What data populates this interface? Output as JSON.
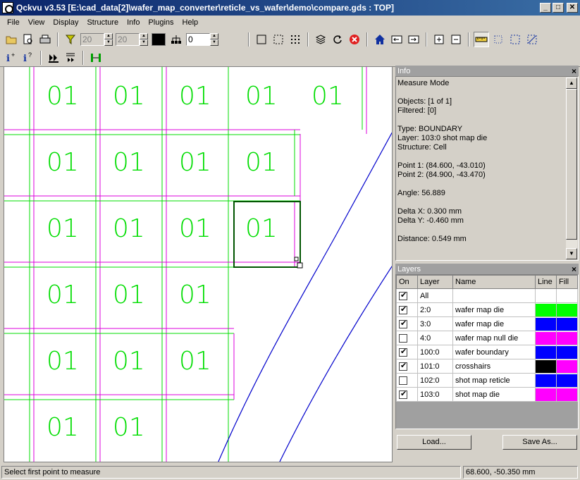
{
  "window": {
    "title": "Qckvu v3.53 [E:\\cad_data[2]\\wafer_map_converter\\reticle_vs_wafer\\demo\\compare.gds : TOP]",
    "minimize": "_",
    "maximize": "□",
    "close": "✕"
  },
  "menu": [
    "File",
    "View",
    "Display",
    "Structure",
    "Info",
    "Plugins",
    "Help"
  ],
  "toolbar": {
    "filter_min": "20",
    "filter_max": "20",
    "hierarchy_depth": "0",
    "accent_color": "#000000"
  },
  "canvas": {
    "die_label": "01",
    "colors": {
      "green": "#00dd00",
      "magenta": "#dd00dd",
      "blue": "#0000cc",
      "highlight": "#005500"
    }
  },
  "info_panel": {
    "title": "Info",
    "lines": [
      "Measure Mode",
      "",
      "Objects: [1 of 1]",
      "Filtered: [0]",
      "",
      "Type: BOUNDARY",
      "Layer: 103:0 shot map die",
      "Structure: Cell",
      "",
      "Point 1: (84.600, -43.010)",
      "Point 2: (84.900, -43.470)",
      "",
      "Angle: 56.889",
      "",
      "Delta X: 0.300 mm",
      "Delta Y: -0.460 mm",
      "",
      "Distance: 0.549 mm"
    ]
  },
  "layers_panel": {
    "title": "Layers",
    "columns": [
      "On",
      "Layer",
      "Name",
      "Line",
      "Fill"
    ],
    "rows": [
      {
        "on": true,
        "layer": "All",
        "name": "",
        "line": "",
        "fill": ""
      },
      {
        "on": true,
        "layer": "2:0",
        "name": "wafer map die",
        "line": "#00ff00",
        "fill": "#00ff00"
      },
      {
        "on": true,
        "layer": "3:0",
        "name": "wafer map die",
        "line": "#0000ff",
        "fill": "#0000ff"
      },
      {
        "on": false,
        "layer": "4:0",
        "name": "wafer map null die",
        "line": "#ff00ff",
        "fill": "#ff00ff"
      },
      {
        "on": true,
        "layer": "100:0",
        "name": "wafer boundary",
        "line": "#0000ff",
        "fill": "#0000ff"
      },
      {
        "on": true,
        "layer": "101:0",
        "name": "crosshairs",
        "line": "#000000",
        "fill": "#ff00ff"
      },
      {
        "on": false,
        "layer": "102:0",
        "name": "shot map reticle",
        "line": "#0000ff",
        "fill": "#0000ff"
      },
      {
        "on": true,
        "layer": "103:0",
        "name": "shot map die",
        "line": "#ff00ff",
        "fill": "#ff00ff"
      }
    ],
    "load_button": "Load...",
    "save_button": "Save As..."
  },
  "status": {
    "message": "Select first point to measure",
    "coords": "68.600, -50.350 mm"
  }
}
